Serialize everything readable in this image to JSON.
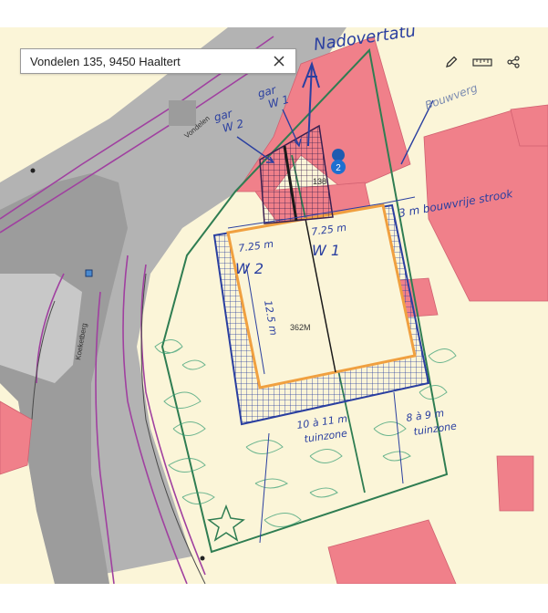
{
  "search": {
    "value": "Vondelen 135, 9450 Haaltert"
  },
  "toolbar": {
    "icons": [
      "pencil-icon",
      "ruler-icon",
      "share-icon"
    ]
  },
  "map": {
    "streets": {
      "vondelen": "Vondelen",
      "koeketberg": "Koeketberg"
    },
    "house_number": "138",
    "pin_number": "2",
    "area_label": "362M",
    "colors": {
      "building": "#f0808a",
      "road": "#b5b5b5",
      "parcel_bg": "#fbf5d8",
      "pen_blue": "#2a3fa0",
      "pen_green": "#2f7d52",
      "pen_orange": "#f0a040",
      "parcel_border": "#a040a0"
    },
    "annotations": {
      "nadevertatum": "Nadovertatu",
      "garage_w2": "gar\nW 2",
      "garage_w1": "gar\nW 1",
      "bouwvergunning": "Bouwverg",
      "bouwvrije_strook": "3 m bouwvrije strook",
      "w1": "W 1",
      "w2": "W 2",
      "dim_725_left": "7.25 m",
      "dim_725_right": "7.25 m",
      "dim_125": "12.5 m",
      "tuin_left": "10 à 11 m\ntuinzone",
      "tuin_right": "8 à 9 m\ntuinzone",
      "north_arrow": "A"
    }
  }
}
